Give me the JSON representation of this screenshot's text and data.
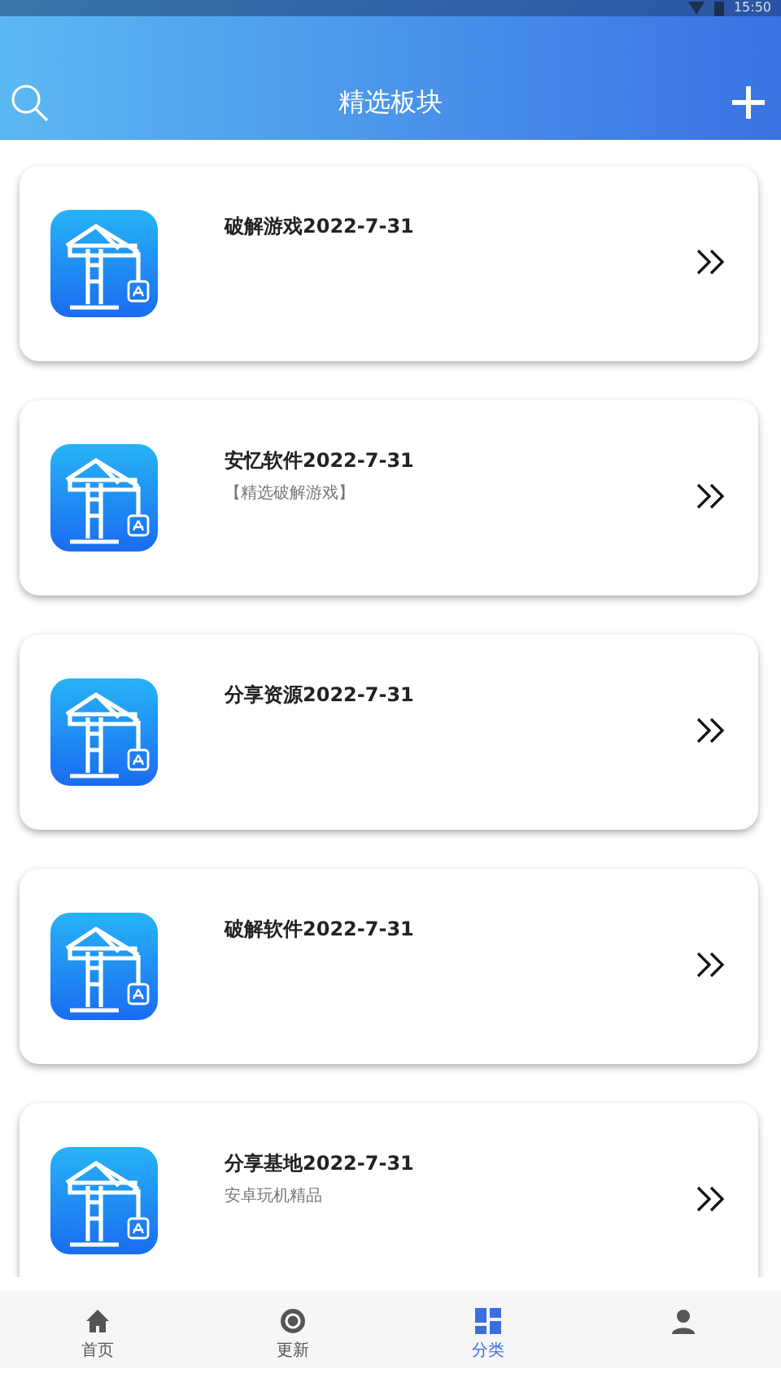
{
  "status_bar": {
    "time": "15:50"
  },
  "header": {
    "title": "精选板块"
  },
  "cards": [
    {
      "title": "破解游戏2022-7-31"
    },
    {
      "title": "安忆软件2022-7-31",
      "subtitle": "【精选破解游戏】"
    },
    {
      "title": "分享资源2022-7-31"
    },
    {
      "title": "破解软件2022-7-31"
    },
    {
      "title": "分享基地2022-7-31",
      "subtitle": "安卓玩机精品"
    }
  ],
  "tabs": [
    {
      "label": "首页",
      "selected": false
    },
    {
      "label": "更新",
      "selected": false
    },
    {
      "label": "分类",
      "selected": true
    },
    {
      "selected": false
    }
  ]
}
